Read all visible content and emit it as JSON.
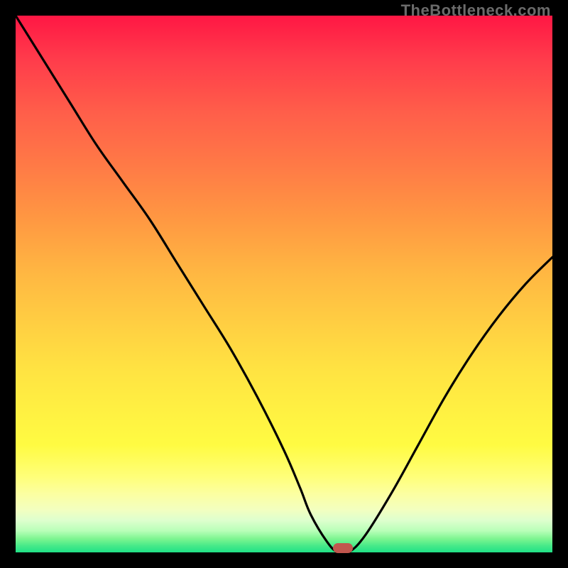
{
  "watermark": "TheBottleneck.com",
  "colors": {
    "frame": "#000000",
    "curve": "#000000",
    "marker": "#c1564e",
    "gradient_top": "#ff1744",
    "gradient_mid": "#ffe342",
    "gradient_bottom": "#20e186"
  },
  "chart_data": {
    "type": "line",
    "title": "",
    "xlabel": "",
    "ylabel": "",
    "xlim": [
      0,
      100
    ],
    "ylim": [
      0,
      100
    ],
    "grid": false,
    "legend": false,
    "series": [
      {
        "name": "bottleneck-curve",
        "x": [
          0,
          5,
          10,
          15,
          20,
          25,
          30,
          35,
          40,
          45,
          50,
          53,
          55,
          58,
          60,
          62,
          65,
          70,
          75,
          80,
          85,
          90,
          95,
          100
        ],
        "values": [
          100,
          92,
          84,
          76,
          69,
          62,
          54,
          46,
          38,
          29,
          19,
          12,
          7,
          2,
          0,
          0,
          3,
          11,
          20,
          29,
          37,
          44,
          50,
          55
        ]
      }
    ],
    "annotations": [
      {
        "name": "optimum-marker",
        "x": 61,
        "y": 0
      }
    ]
  }
}
